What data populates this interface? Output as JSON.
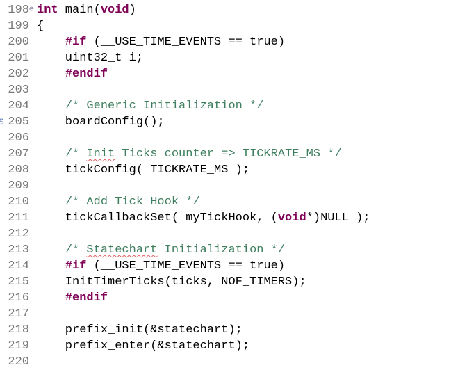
{
  "editor": {
    "lines": [
      {
        "num": "198",
        "marker": "⊖",
        "parts": [
          {
            "t": "int",
            "c": "kw"
          },
          {
            "t": " main(",
            "c": ""
          },
          {
            "t": "void",
            "c": "kw"
          },
          {
            "t": ")",
            "c": ""
          }
        ]
      },
      {
        "num": "199",
        "parts": [
          {
            "t": "{",
            "c": ""
          }
        ]
      },
      {
        "num": "200",
        "parts": [
          {
            "t": "    ",
            "c": ""
          },
          {
            "t": "#if",
            "c": "pp"
          },
          {
            "t": " (__USE_TIME_EVENTS == true)",
            "c": ""
          }
        ]
      },
      {
        "num": "201",
        "parts": [
          {
            "t": "    uint32_t i;",
            "c": ""
          }
        ]
      },
      {
        "num": "202",
        "parts": [
          {
            "t": "    ",
            "c": ""
          },
          {
            "t": "#endif",
            "c": "pp"
          }
        ]
      },
      {
        "num": "203",
        "parts": []
      },
      {
        "num": "204",
        "parts": [
          {
            "t": "    ",
            "c": ""
          },
          {
            "t": "/* Generic Initialization */",
            "c": "cm"
          }
        ]
      },
      {
        "num": "205",
        "link": "S",
        "parts": [
          {
            "t": "    boardConfig();",
            "c": ""
          }
        ]
      },
      {
        "num": "206",
        "parts": []
      },
      {
        "num": "207",
        "parts": [
          {
            "t": "    ",
            "c": ""
          },
          {
            "t": "/* ",
            "c": "cm"
          },
          {
            "t": "Init",
            "c": "cm spell"
          },
          {
            "t": " Ticks counter => TICKRATE_MS */",
            "c": "cm"
          }
        ]
      },
      {
        "num": "208",
        "parts": [
          {
            "t": "    tickConfig( TICKRATE_MS );",
            "c": ""
          }
        ]
      },
      {
        "num": "209",
        "parts": []
      },
      {
        "num": "210",
        "parts": [
          {
            "t": "    ",
            "c": ""
          },
          {
            "t": "/* Add Tick Hook */",
            "c": "cm"
          }
        ]
      },
      {
        "num": "211",
        "parts": [
          {
            "t": "    tickCallbackSet( myTickHook, (",
            "c": ""
          },
          {
            "t": "void",
            "c": "kw"
          },
          {
            "t": "*)NULL );",
            "c": ""
          }
        ]
      },
      {
        "num": "212",
        "parts": []
      },
      {
        "num": "213",
        "parts": [
          {
            "t": "    ",
            "c": ""
          },
          {
            "t": "/* ",
            "c": "cm"
          },
          {
            "t": "Statechart",
            "c": "cm spell"
          },
          {
            "t": " Initialization */",
            "c": "cm"
          }
        ]
      },
      {
        "num": "214",
        "parts": [
          {
            "t": "    ",
            "c": ""
          },
          {
            "t": "#if",
            "c": "pp"
          },
          {
            "t": " (__USE_TIME_EVENTS == true)",
            "c": ""
          }
        ]
      },
      {
        "num": "215",
        "parts": [
          {
            "t": "    InitTimerTicks(ticks, NOF_TIMERS);",
            "c": ""
          }
        ]
      },
      {
        "num": "216",
        "parts": [
          {
            "t": "    ",
            "c": ""
          },
          {
            "t": "#endif",
            "c": "pp"
          }
        ]
      },
      {
        "num": "217",
        "parts": []
      },
      {
        "num": "218",
        "parts": [
          {
            "t": "    prefix_init(&statechart);",
            "c": ""
          }
        ]
      },
      {
        "num": "219",
        "parts": [
          {
            "t": "    prefix_enter(&statechart);",
            "c": ""
          }
        ]
      },
      {
        "num": "220",
        "parts": []
      }
    ]
  },
  "colors": {
    "keyword": "#7f0055",
    "comment": "#3f7f5f",
    "line_number": "#787878",
    "text": "#000000",
    "background": "#ffffff"
  }
}
